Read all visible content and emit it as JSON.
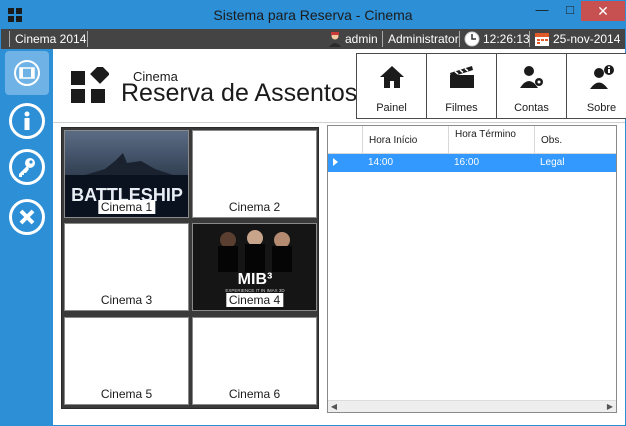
{
  "window": {
    "title": "Sistema para Reserva - Cinema",
    "minimize": "—",
    "maximize": "□",
    "close": "✕"
  },
  "status": {
    "app": "Cinema 2014",
    "user": "admin",
    "role": "Administrator",
    "time": "12:26:13",
    "date": "25-nov-2014"
  },
  "sidebar": {
    "items": [
      "film-icon",
      "info-icon",
      "key-icon",
      "close-circle-icon"
    ]
  },
  "header": {
    "brand_small": "Cinema",
    "brand_big": "Reserva de Assentos"
  },
  "toolbar": {
    "items": [
      {
        "label": "Painel",
        "icon": "home-icon"
      },
      {
        "label": "Filmes",
        "icon": "clapperboard-icon"
      },
      {
        "label": "Contas",
        "icon": "user-settings-icon"
      },
      {
        "label": "Sobre",
        "icon": "user-info-icon"
      }
    ]
  },
  "cinemas": [
    {
      "name": "Cinema 1",
      "poster": "BATTLESHIP"
    },
    {
      "name": "Cinema 2",
      "poster": ""
    },
    {
      "name": "Cinema 3",
      "poster": ""
    },
    {
      "name": "Cinema 4",
      "poster": "MIB³"
    },
    {
      "name": "Cinema 5",
      "poster": ""
    },
    {
      "name": "Cinema 6",
      "poster": ""
    }
  ],
  "mib_tagline": "EXPERIENCE IT IN IMAX 3D",
  "schedule": {
    "columns": [
      "Hora Início",
      "Hora Término",
      "Obs."
    ],
    "rows": [
      {
        "start": "14:00",
        "end": "16:00",
        "obs": "Legal"
      }
    ]
  },
  "colors": {
    "accent": "#2d8fd6",
    "selection": "#3399ff",
    "status_bar": "#444444"
  }
}
